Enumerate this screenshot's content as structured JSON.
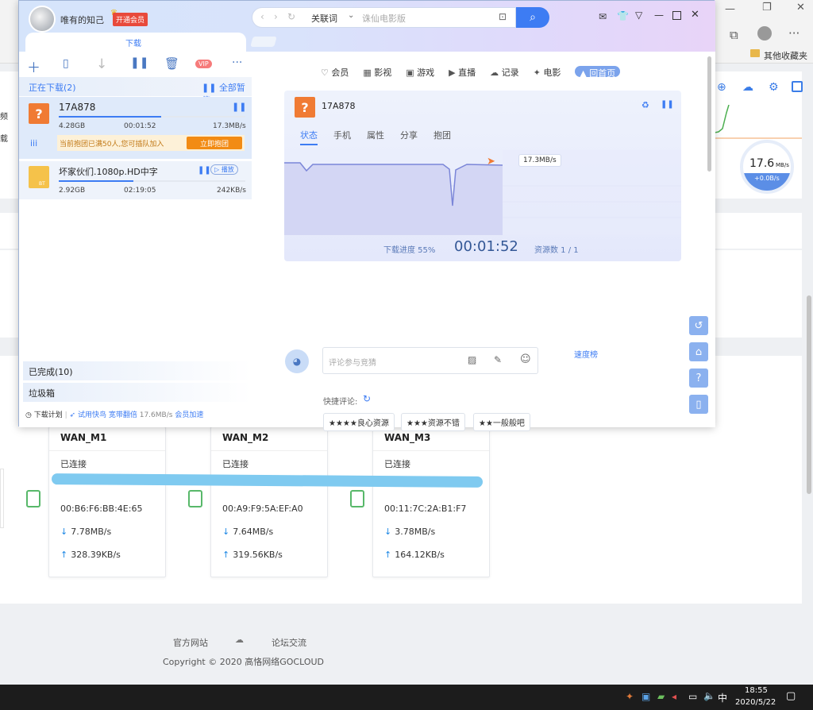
{
  "browser": {
    "bookmark_other": "其他收藏夹",
    "left_cut_text_1": "频",
    "left_cut_text_2": "载",
    "speed_widget": {
      "value": "17.6",
      "unit": "MB/s",
      "sub": "+0.0B/s"
    }
  },
  "router": {
    "wans": [
      {
        "name": "WAN_M1",
        "status": "已连接",
        "mac": "00:B6:F6:BB:4E:65",
        "down": "7.78MB/s",
        "up": "328.39KB/s"
      },
      {
        "name": "WAN_M2",
        "status": "已连接",
        "mac": "00:A9:F9:5A:EF:A0",
        "down": "7.64MB/s",
        "up": "319.56KB/s"
      },
      {
        "name": "WAN_M3",
        "status": "已连接",
        "mac": "00:11:7C:2A:B1:F7",
        "down": "3.78MB/s",
        "up": "164.12KB/s"
      }
    ],
    "footer": {
      "link_official": "官方网站",
      "link_forum": "论坛交流",
      "copyright": "Copyright © 2020 高恪网络GOCLOUD"
    }
  },
  "app": {
    "username": "唯有的知己",
    "vip_button": "开通会员",
    "search": {
      "type": "关联词",
      "placeholder": "诛仙电影版"
    },
    "tab_download": "下载",
    "vip_badge": "VIP",
    "downloading_header": "正在下载(2)",
    "pause_all": "全部暂停",
    "tasks": [
      {
        "name": "17A878",
        "size": "4.28GB",
        "time": "00:01:52",
        "speed": "17.3MB/s",
        "progress": 0.55
      },
      {
        "name": "坏家伙们.1080p.HD中字",
        "size": "2.92GB",
        "time": "02:19:05",
        "speed": "242KB/s",
        "progress": 0.4,
        "play_label": "播放",
        "bt_label": "BT"
      }
    ],
    "team_notice": "当前抱团已满50人,您可插队加入",
    "team_button": "立即抱团",
    "completed": "已完成(10)",
    "trash": "垃圾箱",
    "bottom": {
      "plan": "下载计划",
      "trial": "试用快鸟",
      "bandwidth": "宽带翻倍",
      "speed": "17.6MB/s",
      "member": "会员加速"
    },
    "nav": [
      "会员",
      "影视",
      "游戏",
      "直播",
      "记录",
      "电影",
      "回首页"
    ],
    "detail": {
      "name": "17A878",
      "tabs": [
        "状态",
        "手机",
        "属性",
        "分享",
        "抱团"
      ],
      "speed_tag": "17.3MB/s",
      "progress_label": "下载进度 55%",
      "elapsed": "00:01:52",
      "sources": "资源数 1 / 1"
    },
    "comment": {
      "placeholder": "评论参与竞猜",
      "rank": "速度榜",
      "quick": "快捷评论:",
      "chips": [
        "★★★★良心资源",
        "★★★资源不错",
        "★★一般般吧"
      ]
    }
  },
  "taskbar": {
    "ime": "中",
    "time": "18:55",
    "date": "2020/5/22"
  }
}
